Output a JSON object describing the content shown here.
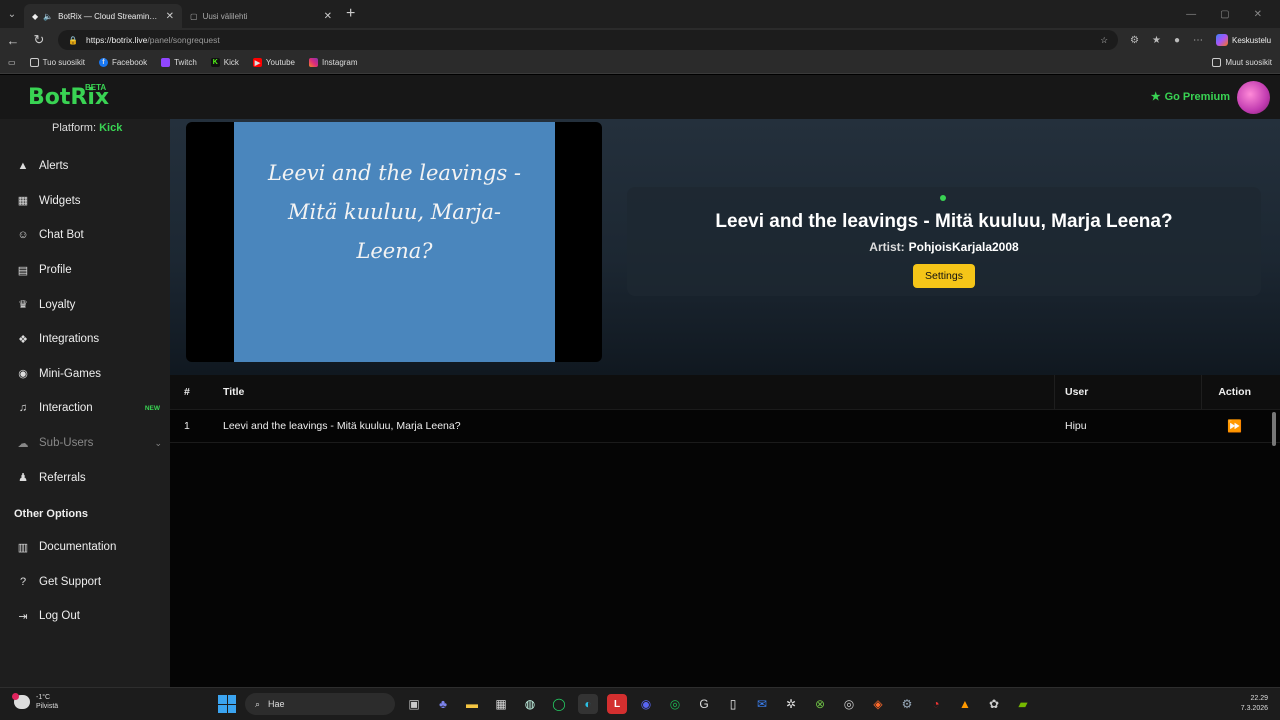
{
  "browser": {
    "tabs": [
      {
        "title": "BotRix — Cloud Streaming Bot",
        "active": true
      },
      {
        "title": "Uusi välilehti",
        "active": false
      }
    ],
    "url_host": "https://botrix.live",
    "url_path": "/panel/songrequest",
    "copilot_label": "Keskustelu",
    "bookmarks": [
      "Tuo suosikit",
      "Facebook",
      "Twitch",
      "Kick",
      "Youtube",
      "Instagram"
    ],
    "other_bookmarks": "Muut suosikit"
  },
  "app": {
    "logo": "BotRix",
    "beta": "BETA",
    "premium_label": "Go Premium",
    "platform_label": "Platform:",
    "platform_value": "Kick",
    "nav": [
      {
        "label": "Alerts",
        "icon": "warning-icon"
      },
      {
        "label": "Widgets",
        "icon": "grid-icon"
      },
      {
        "label": "Chat Bot",
        "icon": "robot-icon"
      },
      {
        "label": "Profile",
        "icon": "id-card-icon"
      },
      {
        "label": "Loyalty",
        "icon": "trophy-icon"
      },
      {
        "label": "Integrations",
        "icon": "cubes-icon"
      },
      {
        "label": "Mini-Games",
        "icon": "gamepad-icon"
      },
      {
        "label": "Interaction",
        "icon": "music-icon",
        "badge": "NEW"
      },
      {
        "label": "Sub-Users",
        "icon": "users-icon"
      },
      {
        "label": "Referrals",
        "icon": "people-icon"
      }
    ],
    "other_options": "Other Options",
    "nav2": [
      {
        "label": "Documentation",
        "icon": "book-icon"
      },
      {
        "label": "Get Support",
        "icon": "question-icon"
      },
      {
        "label": "Log Out",
        "icon": "logout-icon"
      }
    ]
  },
  "player": {
    "thumbnail_text": "Leevi and the leavings - Mitä kuuluu, Marja-Leena?",
    "song_title": "Leevi and the leavings - Mitä kuuluu, Marja Leena?",
    "artist_label": "Artist:",
    "artist_value": "PohjoisKarjala2008",
    "settings_label": "Settings"
  },
  "queue": {
    "columns": [
      "#",
      "Title",
      "User",
      "Action"
    ],
    "rows": [
      {
        "num": "1",
        "title": "Leevi and the leavings - Mitä kuuluu, Marja Leena?",
        "user": "Hipu"
      }
    ]
  },
  "taskbar": {
    "temp": "-1°C",
    "weather": "Pilvistä",
    "search_label": "Hae",
    "time": "22.29",
    "date": "7.3.2026"
  },
  "colors": {
    "accent": "#39d353",
    "settings_button": "#f5c518",
    "thumbnail_bg": "#4a86bd"
  }
}
